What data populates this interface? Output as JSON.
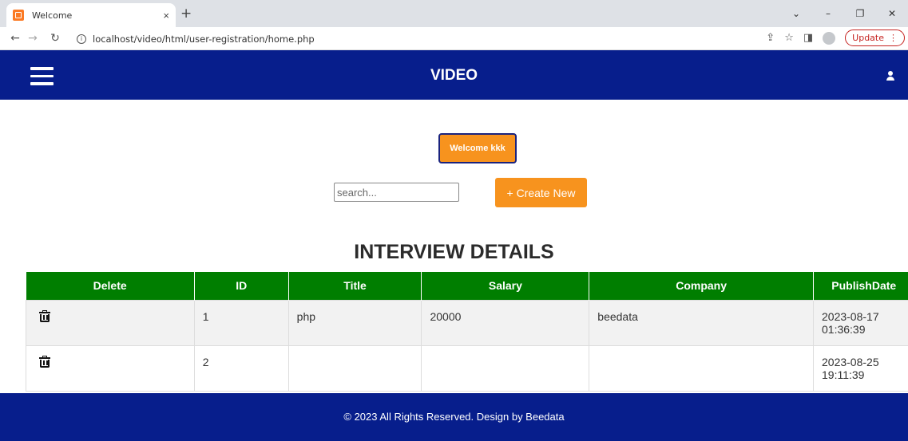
{
  "browser": {
    "tab_title": "Welcome",
    "tab_close": "×",
    "new_tab": "+",
    "url": "localhost/video/html/user-registration/home.php",
    "update_label": "Update",
    "minimize": "–",
    "restore": "❐",
    "close": "✕",
    "tab_search": "⌄"
  },
  "header": {
    "title": "VIDEO"
  },
  "welcome": {
    "label": "Welcome kkk"
  },
  "search": {
    "placeholder": "search..."
  },
  "create_button": {
    "label": "+ Create New"
  },
  "section": {
    "title": "INTERVIEW DETAILS"
  },
  "table": {
    "columns": [
      "Delete",
      "ID",
      "Title",
      "Salary",
      "Company",
      "PublishDate"
    ],
    "rows": [
      {
        "id": "1",
        "title": "php",
        "salary": "20000",
        "company": "beedata",
        "publish_date": "2023-08-17 01:36:39"
      },
      {
        "id": "2",
        "title": "",
        "salary": "",
        "company": "",
        "publish_date": "2023-08-25 19:11:39"
      }
    ]
  },
  "footer": {
    "text": "© 2023 All Rights Reserved. Design by Beedata"
  }
}
